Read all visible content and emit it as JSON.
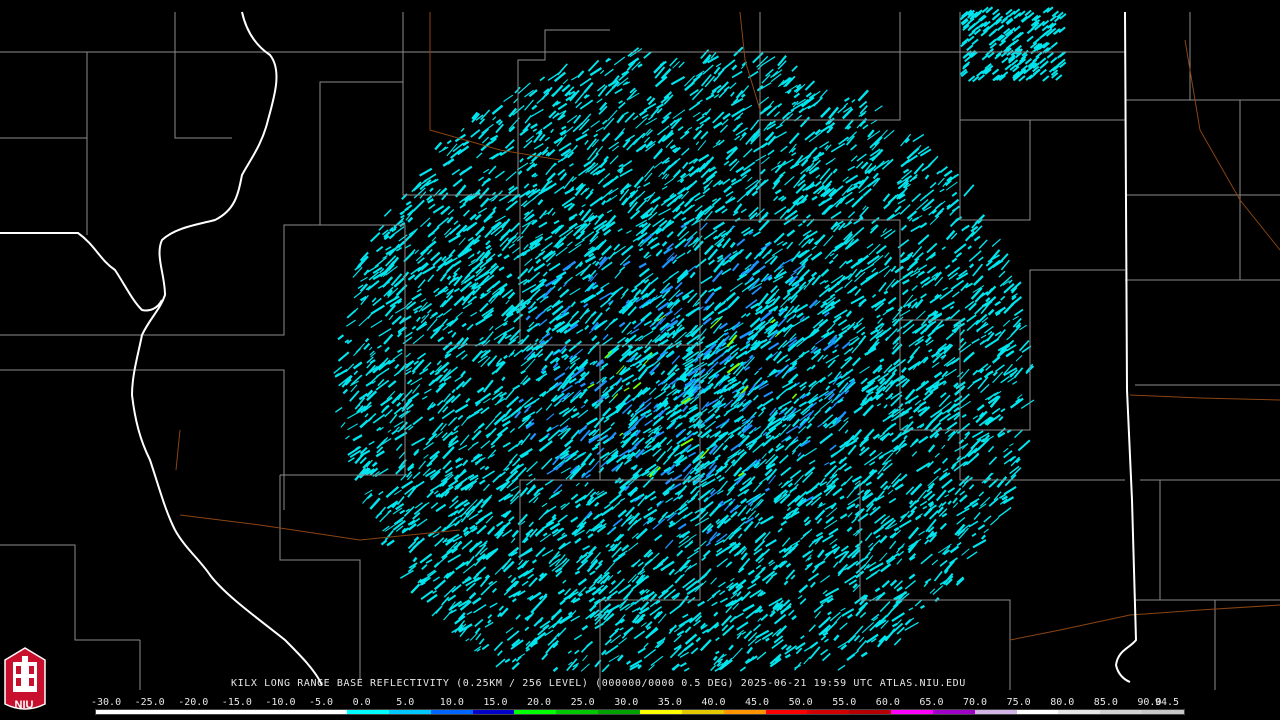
{
  "caption": "KILX LONG RANGE BASE REFLECTIVITY (0.25KM / 256 LEVEL) (000000/0000 0.5 DEG) 2025-06-21 19:59 UTC  ATLAS.NIU.EDU",
  "scale": {
    "labels": [
      "-30.0",
      "-25.0",
      "-20.0",
      "-15.0",
      "-10.0",
      "-5.0",
      "0.0",
      "5.0",
      "10.0",
      "15.0",
      "20.0",
      "25.0",
      "30.0",
      "35.0",
      "40.0",
      "45.0",
      "50.0",
      "55.0",
      "60.0",
      "65.0",
      "70.0",
      "75.0",
      "80.0",
      "85.0",
      "90.0",
      "94.5"
    ],
    "colors": [
      "#ffffff",
      "#ffffff",
      "#ffffff",
      "#ffffff",
      "#ffffff",
      "#ffffff",
      "#00ffff",
      "#00c8ff",
      "#0064ff",
      "#0000c8",
      "#00ff00",
      "#00c800",
      "#00a000",
      "#ffff00",
      "#e6c800",
      "#ff9600",
      "#ff0000",
      "#d20000",
      "#b40000",
      "#ff00ff",
      "#a000c8",
      "#d2b4e6",
      "#ffffff",
      "#e6e6e6",
      "#d2d2d2",
      "#c8c8c8"
    ]
  },
  "logo": {
    "text": "NIU",
    "background": "#c8102e"
  },
  "colors": {
    "background": "#000000",
    "county_lines": "#8c8c8c",
    "state_lines": "#ffffff",
    "roads": "#8b4513",
    "echo_light": "#00e5ee",
    "echo_medium": "#1e90ff",
    "echo_strong": "#7cfc00"
  }
}
